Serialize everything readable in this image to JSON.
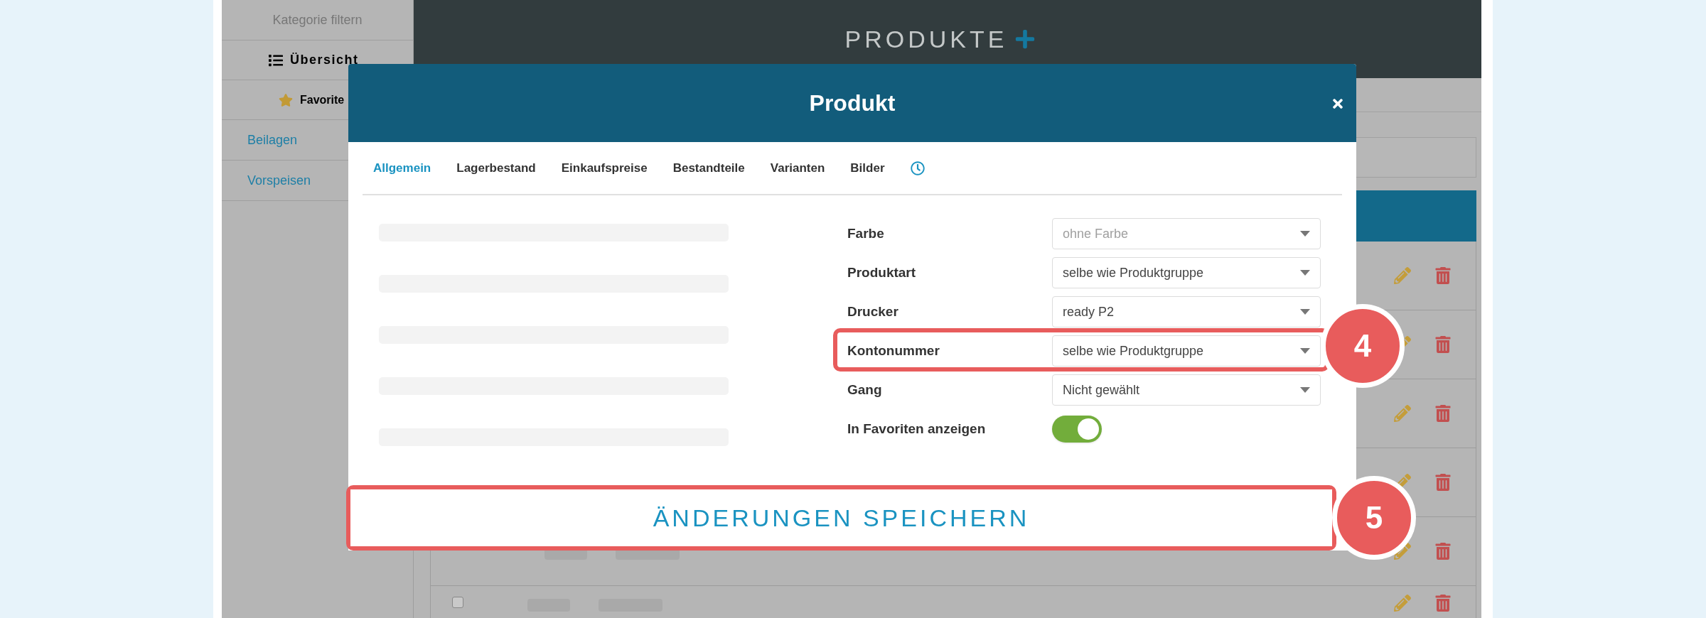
{
  "sidebar": {
    "filter_label": "Kategorie filtern",
    "items": [
      {
        "label": "Übersicht",
        "kind": "list"
      },
      {
        "label": "Favorite",
        "kind": "star"
      },
      {
        "label": "Beilagen",
        "kind": "category"
      },
      {
        "label": "Vorspeisen",
        "kind": "category"
      }
    ]
  },
  "header": {
    "title": "PRODUKTE"
  },
  "table": {
    "rows": [
      {
        "checked": false
      }
    ]
  },
  "modal": {
    "title": "Produkt",
    "tabs": [
      {
        "label": "Allgemein",
        "kind": "text",
        "selected": true
      },
      {
        "label": "Lagerbestand",
        "kind": "text",
        "selected": false
      },
      {
        "label": "Einkaufspreise",
        "kind": "text",
        "selected": false
      },
      {
        "label": "Bestandteile",
        "kind": "text",
        "selected": false
      },
      {
        "label": "Varianten",
        "kind": "text",
        "selected": false
      },
      {
        "label": "Bilder",
        "kind": "text",
        "selected": false
      },
      {
        "kind": "history",
        "selected": false
      }
    ],
    "fields": [
      {
        "label": "Farbe",
        "kind": "select",
        "placeholder": "ohne Farbe"
      },
      {
        "label": "Produktart",
        "kind": "select",
        "value": "selbe wie Produktgruppe"
      },
      {
        "label": "Drucker",
        "kind": "select",
        "value": "ready P2"
      },
      {
        "label": "Kontonummer",
        "kind": "select",
        "value": "selbe wie Produktgruppe",
        "callout": "4"
      },
      {
        "label": "Gang",
        "kind": "select",
        "value": "Nicht gewählt"
      },
      {
        "label": "In Favoriten anzeigen",
        "kind": "toggle",
        "on": true
      }
    ],
    "save_button": {
      "label": "ÄNDERUNGEN SPEICHERN",
      "callout": "5"
    }
  }
}
